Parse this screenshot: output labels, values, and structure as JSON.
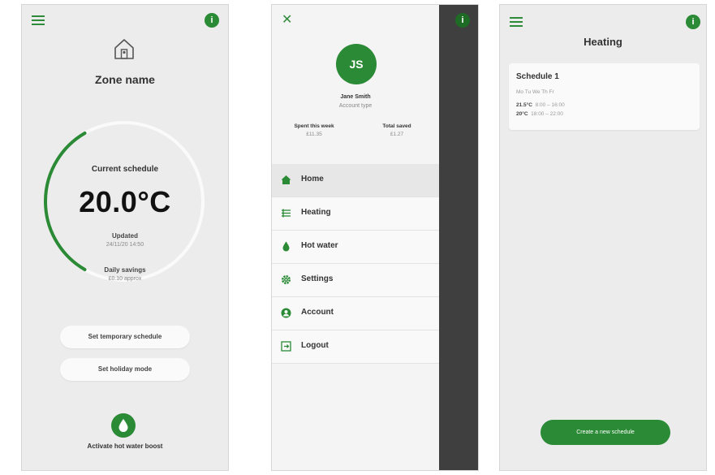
{
  "home": {
    "zone_name": "Zone name",
    "current_schedule_label": "Current schedule",
    "temperature": "20.0°C",
    "updated_label": "Updated",
    "updated_value": "24/11/20 14:50",
    "savings_label": "Daily savings",
    "savings_value": "£0.10 approx",
    "temporary_schedule_button": "Set temporary schedule",
    "holiday_mode_button": "Set holiday mode",
    "hot_water_boost_label": "Activate hot water boost",
    "info_icon": "i",
    "accent_color": "#2a8a35"
  },
  "drawer": {
    "close_icon": "✕",
    "initials": "JS",
    "user_name": "Jane Smith",
    "account_type": "Account type",
    "spent_label": "Spent this week",
    "spent_value": "£11.35",
    "saved_label": "Total saved",
    "saved_value": "£1.27",
    "menu": [
      {
        "label": "Home",
        "icon": "home-icon",
        "active": true
      },
      {
        "label": "Heating",
        "icon": "heating-icon",
        "active": false
      },
      {
        "label": "Hot water",
        "icon": "water-drop-icon",
        "active": false
      },
      {
        "label": "Settings",
        "icon": "gear-icon",
        "active": false
      },
      {
        "label": "Account",
        "icon": "account-icon",
        "active": false
      },
      {
        "label": "Logout",
        "icon": "logout-icon",
        "active": false
      }
    ],
    "info_icon": "i"
  },
  "heating": {
    "title": "Heating",
    "schedule_title": "Schedule 1",
    "days": "Mo  Tu  We  Th  Fr",
    "entry1_temp": "21.5°C",
    "entry1_time": "8:00 – 16:00",
    "entry2_temp": "20°C",
    "entry2_time": "18:00 – 22:00",
    "create_button": "Create a new schedule",
    "info_icon": "i"
  }
}
